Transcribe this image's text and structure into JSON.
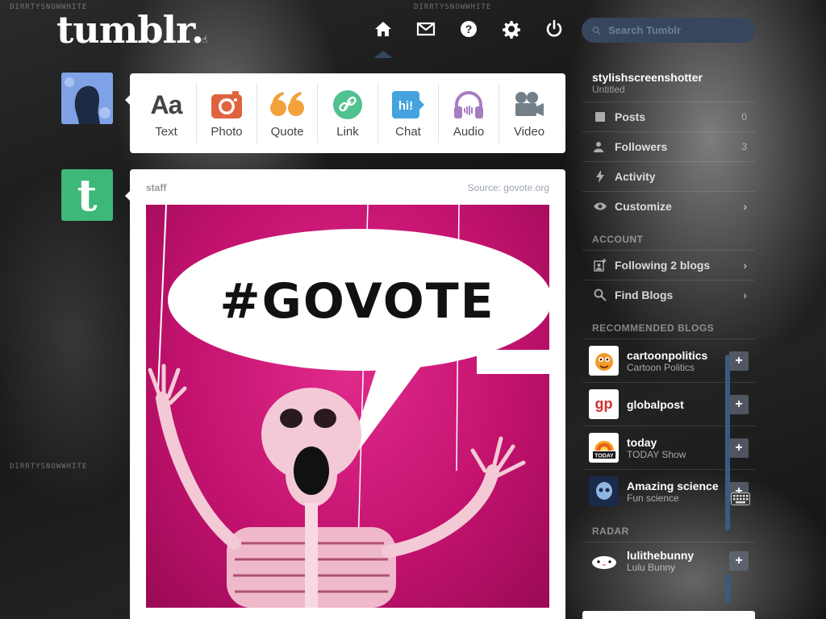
{
  "watermark": "DIRRTYSNOWWHITE",
  "logo": "tumblr.",
  "nav": [
    {
      "name": "home-icon",
      "active": true
    },
    {
      "name": "envelope-icon",
      "active": false
    },
    {
      "name": "help-icon",
      "active": false
    },
    {
      "name": "gear-icon",
      "active": false
    },
    {
      "name": "power-icon",
      "active": false
    }
  ],
  "search": {
    "placeholder": "Search Tumblr"
  },
  "post_types": [
    {
      "label": "Text",
      "icon": "text-icon"
    },
    {
      "label": "Photo",
      "icon": "camera-icon"
    },
    {
      "label": "Quote",
      "icon": "quote-icon"
    },
    {
      "label": "Link",
      "icon": "link-icon"
    },
    {
      "label": "Chat",
      "icon": "chat-icon",
      "badge": "hi!"
    },
    {
      "label": "Audio",
      "icon": "headphones-icon"
    },
    {
      "label": "Video",
      "icon": "video-camera-icon"
    }
  ],
  "post": {
    "author": "staff",
    "source": "Source: govote.org",
    "image_text": "#GOVOTE"
  },
  "sidebar": {
    "blog_name": "stylishscreenshotter",
    "blog_subtitle": "Untitled",
    "rows": [
      {
        "label": "Posts",
        "count": "0",
        "icon": "posts-icon"
      },
      {
        "label": "Followers",
        "count": "3",
        "icon": "followers-icon"
      },
      {
        "label": "Activity",
        "count": "",
        "icon": "activity-icon"
      },
      {
        "label": "Customize",
        "count": "",
        "icon": "eye-icon",
        "chevron": true
      }
    ],
    "account_title": "ACCOUNT",
    "account_rows": [
      {
        "label": "Following 2 blogs",
        "icon": "following-icon",
        "chevron": true
      },
      {
        "label": "Find Blogs",
        "icon": "find-blogs-icon",
        "chevron": true
      }
    ],
    "recommended_title": "RECOMMENDED BLOGS",
    "recommended": [
      {
        "name": "cartoonpolitics",
        "title": "Cartoon Politics",
        "thumb_color": "#ffffff"
      },
      {
        "name": "globalpost",
        "title": "",
        "thumb_color": "#ffffff"
      },
      {
        "name": "today",
        "title": "TODAY Show",
        "thumb_color": "#ffffff"
      },
      {
        "name": "Amazing science",
        "title": "Fun science",
        "thumb_color": "#1a2a4a"
      }
    ],
    "radar_title": "RADAR",
    "radar": {
      "name": "lulithebunny",
      "title": "Lulu Bunny"
    }
  }
}
